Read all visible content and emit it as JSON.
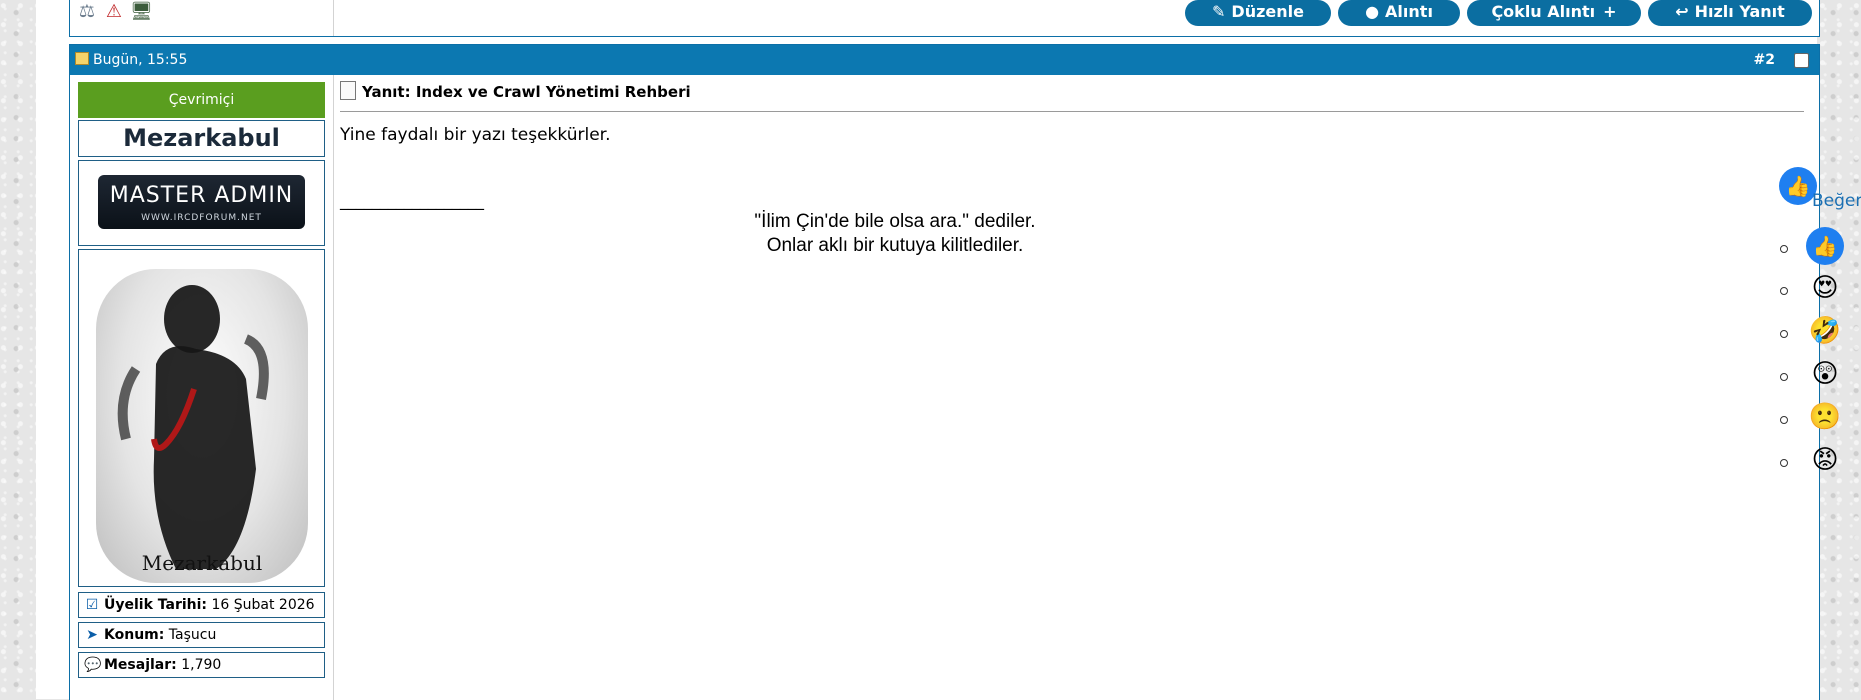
{
  "prev_post": {
    "icons": [
      "scales-icon",
      "warning-icon",
      "computer-icon"
    ],
    "buttons": {
      "edit": "Düzenle",
      "quote": "Alıntı",
      "multi_quote": "Çoklu Alıntı",
      "quick_reply": "Hızlı Yanıt"
    }
  },
  "post": {
    "date": "Bugün, 15:55",
    "number": "#2",
    "status": "Çevrimiçi",
    "username": "Mezarkabul",
    "rank": {
      "line1": "MASTER ADMIN",
      "line2": "WWW.IRCDFORUM.NET"
    },
    "avatar_signature": "Mezarkabul",
    "info": [
      {
        "label": "Üyelik Tarihi:",
        "value": "16 Şubat 2026"
      },
      {
        "label": "Konum:",
        "value": "Taşucu"
      },
      {
        "label": "Mesajlar:",
        "value": "1,790"
      }
    ],
    "title": "Yanıt: Index ve Crawl Yönetimi Rehberi",
    "message": "Yine faydalı bir yazı teşekkürler.",
    "signature_separator": "__________________",
    "signature_lines": [
      "\"İlim Çin'de bile olsa ara.\" dediler.",
      "Onlar aklı bir kutuya kilitlediler."
    ],
    "like_label": "Beğen",
    "reactions": [
      "like",
      "love",
      "haha",
      "wow",
      "sad",
      "angry"
    ]
  },
  "colors": {
    "header": "#0c78b1",
    "button": "#0b6ea1",
    "online": "#5a9e1f"
  }
}
